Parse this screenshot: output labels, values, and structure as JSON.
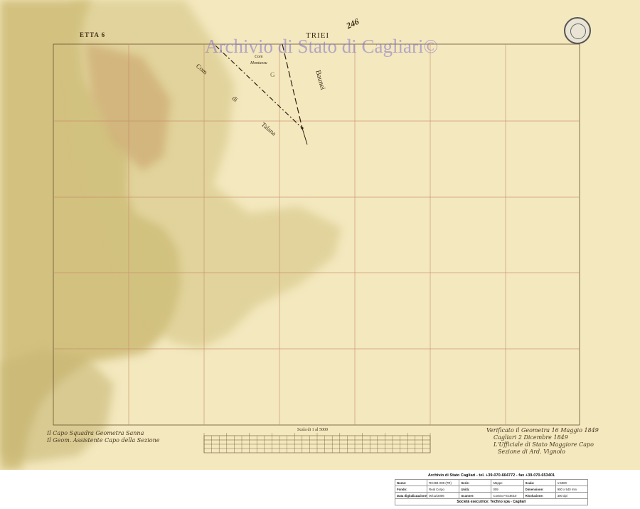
{
  "map": {
    "sheet_header": "ETTA 6",
    "sheet_number": "246",
    "region_label": "TRIEI",
    "watermark": "Archivio di Stato di Cagliari©",
    "place_labels": [
      {
        "id": "com-monteazzu",
        "text": "Com\nMontaezu"
      },
      {
        "id": "com",
        "text": "Com"
      },
      {
        "id": "di",
        "text": "di"
      },
      {
        "id": "talana",
        "text": "Talana"
      },
      {
        "id": "baunei",
        "text": "Baunei"
      },
      {
        "id": "g",
        "text": "G"
      }
    ],
    "colors": {
      "paper": "#f6ecc4",
      "stain": "#c7b46a",
      "grid_line": "#c98a6a",
      "ink": "#3d2c18"
    },
    "scale_bar": {
      "title": "Scala di 1 al 5000"
    },
    "signatures": {
      "left": [
        "Il Capo Squadra  Geometra Sanna",
        "Il Geom. Assistente Capo della Sezione"
      ],
      "right": [
        "Verificato il Geometra 16 Maggio 1849",
        "Cagliari 2 Dicembre 1849",
        "L'Ufficiale di Stato Maggiore Capo",
        "Sezione di Ard. Vignolo"
      ]
    }
  },
  "footer": {
    "title": "Archivio di Stato Cagliari - tel. +39-070-664772 - fax +39-070-653401",
    "rows": [
      [
        {
          "k": "Nome:"
        },
        {
          "v": "RC294-009 (TR)"
        },
        {
          "k": "Serie:"
        },
        {
          "v": "Mappe"
        },
        {
          "k": "Scala:"
        },
        {
          "v": "1:5000"
        }
      ],
      [
        {
          "k": "Fondo:"
        },
        {
          "v": "Real Corpo"
        },
        {
          "k": "Unità:"
        },
        {
          "v": "009"
        },
        {
          "k": "Dimensione:"
        },
        {
          "v": "900 x 540 mm"
        }
      ],
      [
        {
          "k": "Data digitalizzazione:"
        },
        {
          "v": "00/12/2006"
        },
        {
          "k": "Scanner:"
        },
        {
          "v": "Contex FSC8010"
        },
        {
          "k": "Risoluzione:"
        },
        {
          "v": "300 dpi"
        }
      ]
    ],
    "bottom": "Società esecutrice: Techno spa - Cagliari"
  }
}
